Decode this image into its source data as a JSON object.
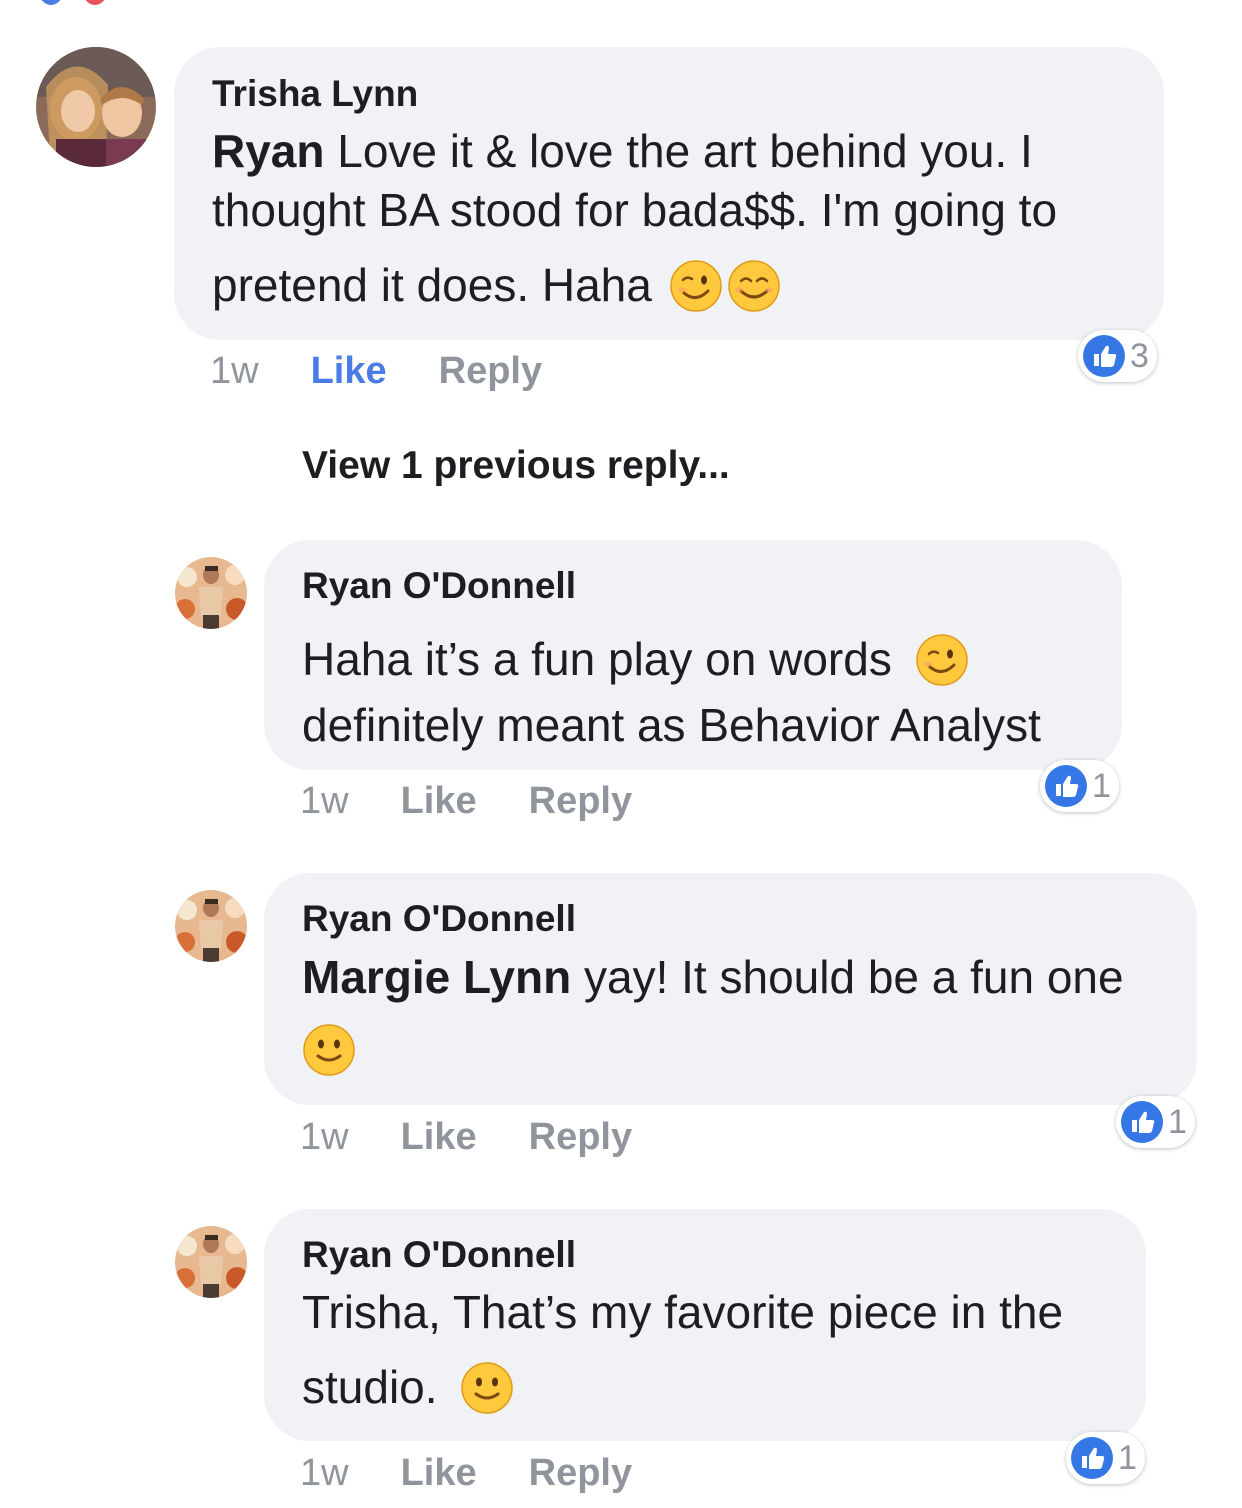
{
  "top_icons": [
    "blue-dot",
    "red-dot"
  ],
  "comments": [
    {
      "author": "Trisha Lynn",
      "mention": "Ryan",
      "lines": [
        " Love it & love the art behind you. I",
        "thought BA stood for bada$$. I'm going to",
        "pretend it does. Haha"
      ],
      "emojis": [
        "winking-face-emoji",
        "smiling-face-emoji"
      ],
      "time": "1w",
      "like_label": "Like",
      "reply_label": "Reply",
      "reaction_count": "3"
    }
  ],
  "view_previous": "View 1 previous reply...",
  "replies": [
    {
      "author": "Ryan O'Donnell",
      "lines": [
        "Haha it’s a fun play on words",
        "definitely meant as Behavior Analyst"
      ],
      "emojis": [
        "winking-face-emoji"
      ],
      "time": "1w",
      "like_label": "Like",
      "reply_label": "Reply",
      "reaction_count": "1"
    },
    {
      "author": "Ryan O'Donnell",
      "mention": "Margie Lynn",
      "lines": [
        " yay! It should be a fun one"
      ],
      "emojis": [
        "slightly-smiling-face-emoji"
      ],
      "time": "1w",
      "like_label": "Like",
      "reply_label": "Reply",
      "reaction_count": "1"
    },
    {
      "author": "Ryan O'Donnell",
      "lines": [
        "Trisha, That’s my favorite piece in the",
        "studio."
      ],
      "emojis": [
        "slightly-smiling-face-emoji"
      ],
      "time": "1w",
      "like_label": "Like",
      "reply_label": "Reply",
      "reaction_count": "1"
    }
  ],
  "colors": {
    "bubble": "#f0f2f5",
    "like_active": "#4a7ce8",
    "meta_gray": "#90949c",
    "like_badge": "#3578e5"
  }
}
